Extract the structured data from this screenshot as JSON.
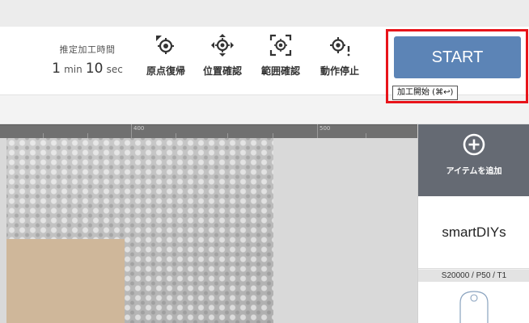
{
  "estimate": {
    "label": "推定加工時間",
    "minutes": "1",
    "min_unit": "min",
    "seconds": "10",
    "sec_unit": "sec"
  },
  "tools": [
    {
      "label": "原点復帰",
      "icon": "home-target-icon"
    },
    {
      "label": "位置確認",
      "icon": "move-crosshair-icon"
    },
    {
      "label": "範囲確認",
      "icon": "frame-target-icon"
    },
    {
      "label": "動作停止",
      "icon": "stop-target-icon"
    }
  ],
  "start": {
    "label": "START",
    "tooltip": "加工開始 (⌘↩)",
    "color": "#5c84b6",
    "highlight_color": "#e8141a"
  },
  "ruler": {
    "labels": [
      "400",
      "500"
    ]
  },
  "sidebar": {
    "add_item_label": "アイテムを追加",
    "material_name": "smartDIYs",
    "settings": "S20000 / P50 / T1"
  }
}
